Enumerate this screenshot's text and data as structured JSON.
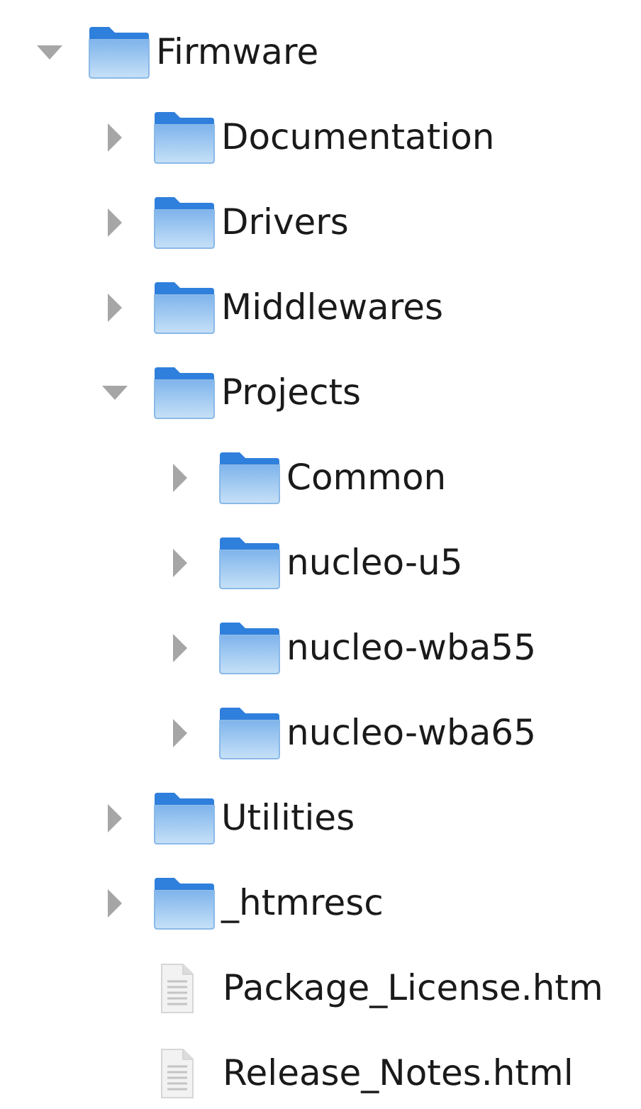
{
  "tree": [
    {
      "name": "Firmware",
      "kind": "folder",
      "expanded": true,
      "children": [
        {
          "name": "Documentation",
          "kind": "folder",
          "expanded": false
        },
        {
          "name": "Drivers",
          "kind": "folder",
          "expanded": false
        },
        {
          "name": "Middlewares",
          "kind": "folder",
          "expanded": false
        },
        {
          "name": "Projects",
          "kind": "folder",
          "expanded": true,
          "children": [
            {
              "name": "Common",
              "kind": "folder",
              "expanded": false
            },
            {
              "name": "nucleo-u5",
              "kind": "folder",
              "expanded": false
            },
            {
              "name": "nucleo-wba55",
              "kind": "folder",
              "expanded": false
            },
            {
              "name": "nucleo-wba65",
              "kind": "folder",
              "expanded": false
            }
          ]
        },
        {
          "name": "Utilities",
          "kind": "folder",
          "expanded": false
        },
        {
          "name": "_htmresc",
          "kind": "folder",
          "expanded": false
        },
        {
          "name": "Package_License.htm",
          "kind": "file"
        },
        {
          "name": "Release_Notes.html",
          "kind": "file"
        }
      ]
    }
  ]
}
